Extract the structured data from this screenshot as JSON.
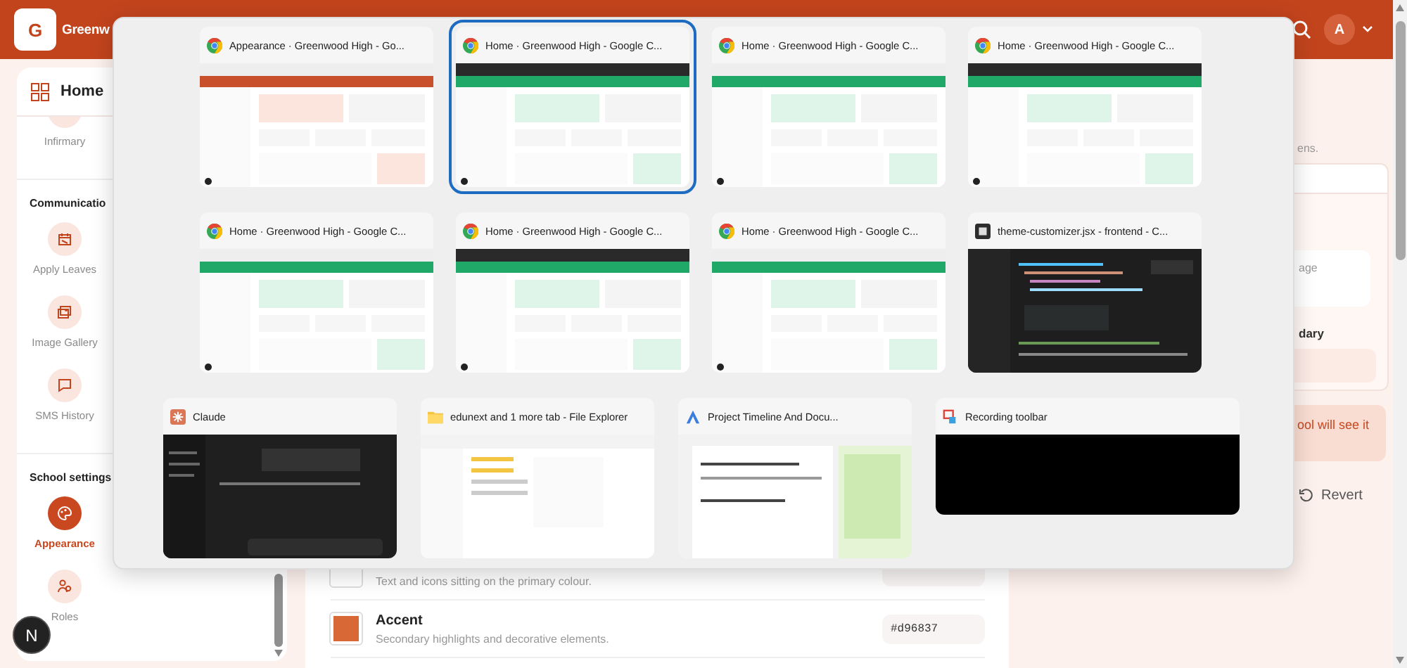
{
  "header": {
    "logo": "G",
    "title": "Greenw",
    "avatar": "A"
  },
  "sidebar": {
    "home": "Home",
    "sections": [
      {
        "items": [
          {
            "label": "Infirmary",
            "kind": "infirmary",
            "selected": false
          }
        ]
      },
      {
        "title": "Communicatio",
        "items": [
          {
            "label": "Apply Leaves",
            "kind": "leave",
            "selected": false
          },
          {
            "label": "Image Gallery",
            "kind": "gallery",
            "selected": false
          },
          {
            "label": "SMS History",
            "kind": "chat",
            "selected": false
          }
        ]
      },
      {
        "title": "School settings",
        "items": [
          {
            "label": "Appearance",
            "kind": "palette",
            "selected": true
          },
          {
            "label": "Roles",
            "kind": "roles",
            "selected": false
          }
        ]
      }
    ]
  },
  "color_rows": [
    {
      "description": "Text and icons sitting on the primary colour.",
      "color": "#ffffff"
    },
    {
      "name": "Accent",
      "description": "Secondary highlights and decorative elements.",
      "color": "#d96837",
      "hex": "#d96837"
    }
  ],
  "side_panel": {
    "note": "ens.",
    "field_text": "age",
    "label": "dary",
    "warning": "ool will see it",
    "revert": "Revert"
  },
  "dev_badge": "N",
  "task_switcher": {
    "rows": [
      [
        {
          "title": "Appearance · Greenwood High - Go...",
          "kind": "browser",
          "selected": false
        },
        {
          "title": "Home · Greenwood High - Google C...",
          "kind": "browser",
          "selected": true
        },
        {
          "title": "Home · Greenwood High - Google C...",
          "kind": "browser",
          "selected": false
        },
        {
          "title": "Home · Greenwood High - Google C...",
          "kind": "browser",
          "selected": false
        }
      ],
      [
        {
          "title": "Home · Greenwood High - Google C...",
          "kind": "browser",
          "selected": false
        },
        {
          "title": "Home · Greenwood High - Google C...",
          "kind": "browser",
          "selected": false
        },
        {
          "title": "Home · Greenwood High - Google C...",
          "kind": "browser",
          "selected": false
        },
        {
          "title": "theme-customizer.jsx - frontend - C...",
          "kind": "editor",
          "selected": false
        }
      ],
      [
        {
          "title": "Claude",
          "kind": "chat",
          "selected": false
        },
        {
          "title": "edunext and 1 more tab - File Explorer",
          "kind": "files",
          "selected": false
        },
        {
          "title": "Project Timeline And Docu...",
          "kind": "docs",
          "selected": false
        },
        {
          "title": "Recording toolbar",
          "kind": "recorder",
          "selected": false
        }
      ]
    ]
  }
}
